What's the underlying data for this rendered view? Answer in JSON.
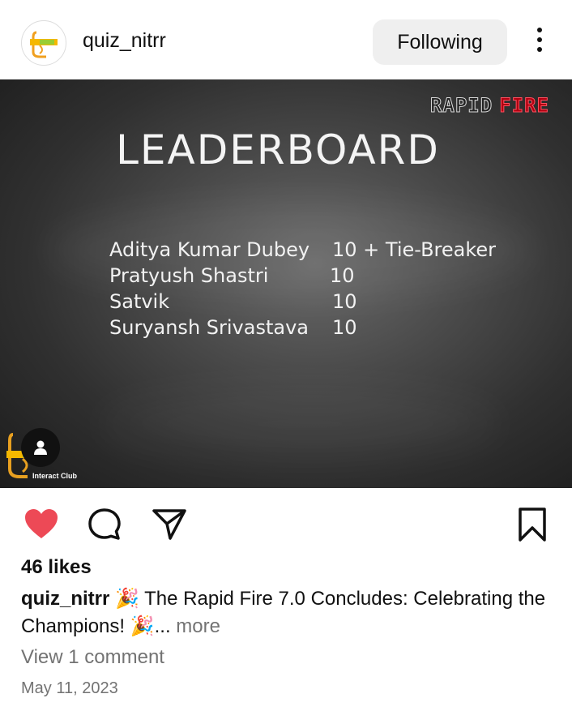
{
  "header": {
    "username": "quiz_nitrr",
    "follow_label": "Following"
  },
  "post_image": {
    "badge_white": "RAPID",
    "badge_red": "FIRE",
    "title": "LEADERBOARD",
    "rows": [
      {
        "name": "Aditya Kumar Dubey",
        "score": "10 + Tie-Breaker"
      },
      {
        "name": "Pratyush Shastri",
        "score": "10"
      },
      {
        "name": "Satvik",
        "score": "10"
      },
      {
        "name": "Suryansh Srivastava",
        "score": "10"
      }
    ],
    "club_label": "Interact Club"
  },
  "actions": {
    "like_icon": "heart-filled-icon",
    "comment_icon": "comment-icon",
    "share_icon": "send-icon",
    "save_icon": "bookmark-icon",
    "like_color": "#ed4956"
  },
  "likes_text": "46 likes",
  "caption": {
    "username": "quiz_nitrr",
    "emoji_start": "🎉",
    "text": " The Rapid Fire 7.0 Concludes: Celebrating the Champions! ",
    "emoji_end": "🎉",
    "ellipsis": "...",
    "more_label": " more"
  },
  "view_comments": "View 1 comment",
  "date": "May 11, 2023"
}
